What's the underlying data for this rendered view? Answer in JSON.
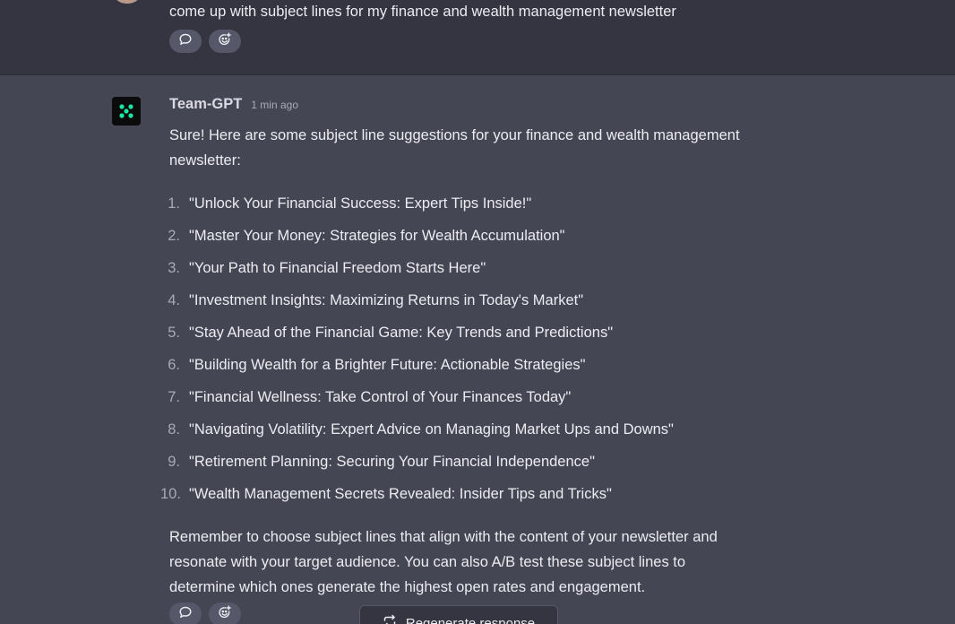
{
  "user_message": {
    "text": "come up with subject lines for my finance and wealth management newsletter",
    "actions": [
      {
        "icon": "comment-icon"
      },
      {
        "icon": "add-reaction-icon"
      }
    ]
  },
  "assistant_message": {
    "author": "Team-GPT",
    "timestamp": "1 min ago",
    "intro": "Sure! Here are some subject line suggestions for your finance and wealth management newsletter:",
    "items": [
      {
        "num": "1.",
        "text": "\"Unlock Your Financial Success: Expert Tips Inside!\""
      },
      {
        "num": "2.",
        "text": "\"Master Your Money: Strategies for Wealth Accumulation\""
      },
      {
        "num": "3.",
        "text": "\"Your Path to Financial Freedom Starts Here\""
      },
      {
        "num": "4.",
        "text": "\"Investment Insights: Maximizing Returns in Today's Market\""
      },
      {
        "num": "5.",
        "text": "\"Stay Ahead of the Financial Game: Key Trends and Predictions\""
      },
      {
        "num": "6.",
        "text": "\"Building Wealth for a Brighter Future: Actionable Strategies\""
      },
      {
        "num": "7.",
        "text": "\"Financial Wellness: Take Control of Your Finances Today\""
      },
      {
        "num": "8.",
        "text": "\"Navigating Volatility: Expert Advice on Managing Market Ups and Downs\""
      },
      {
        "num": "9.",
        "text": "\"Retirement Planning: Securing Your Financial Independence\""
      },
      {
        "num": "10.",
        "text": "\"Wealth Management Secrets Revealed: Insider Tips and Tricks\""
      }
    ],
    "outro": "Remember to choose subject lines that align with the content of your newsletter and resonate with your target audience. You can also A/B test these subject lines to determine which ones generate the highest open rates and engagement.",
    "actions": [
      {
        "icon": "comment-icon"
      },
      {
        "icon": "add-reaction-icon"
      }
    ]
  },
  "regenerate": {
    "label": "Regenerate response",
    "icon": "regenerate-icon"
  },
  "colors": {
    "assistant_bg": "#444654",
    "user_bg": "#343541",
    "accent": "#19e6a0"
  }
}
